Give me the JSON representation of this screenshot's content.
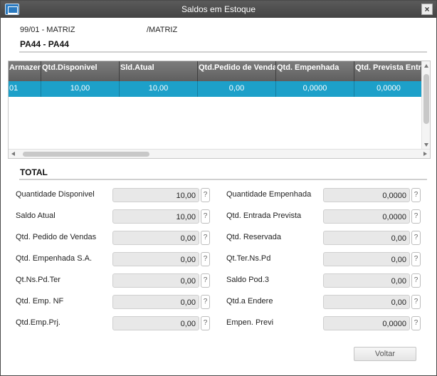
{
  "window": {
    "title": "Saldos em Estoque"
  },
  "header": {
    "branch": "99/01 - MATRIZ",
    "company": "/MATRIZ",
    "product": "PA44 - PA44"
  },
  "grid": {
    "columns": [
      "Armazem",
      "Qtd.Disponivel",
      "Sld.Atual",
      "Qtd.Pedido de Vendas",
      "Qtd. Empenhada",
      "Qtd. Prevista Entrada"
    ],
    "rows": [
      [
        "01",
        "10,00",
        "10,00",
        "0,00",
        "0,0000",
        "0,0000"
      ]
    ]
  },
  "total": {
    "title": "TOTAL",
    "left": [
      {
        "label": "Quantidade Disponivel",
        "value": "10,00"
      },
      {
        "label": "Saldo Atual",
        "value": "10,00"
      },
      {
        "label": "Qtd. Pedido de Vendas",
        "value": "0,00"
      },
      {
        "label": "Qtd. Empenhada S.A.",
        "value": "0,00"
      },
      {
        "label": "Qt.Ns.Pd.Ter",
        "value": "0,00"
      },
      {
        "label": "Qtd. Emp. NF",
        "value": "0,00"
      },
      {
        "label": "Qtd.Emp.Prj.",
        "value": "0,00"
      }
    ],
    "right": [
      {
        "label": "Quantidade Empenhada",
        "value": "0,0000"
      },
      {
        "label": "Qtd. Entrada Prevista",
        "value": "0,0000"
      },
      {
        "label": "Qtd. Reservada",
        "value": "0,00"
      },
      {
        "label": "Qt.Ter.Ns.Pd",
        "value": "0,00"
      },
      {
        "label": "Saldo Pod.3",
        "value": "0,00"
      },
      {
        "label": "Qtd.a Endere",
        "value": "0,00"
      },
      {
        "label": "Empen. Previ",
        "value": "0,0000"
      }
    ],
    "help_glyph": "?"
  },
  "buttons": {
    "close": "×",
    "back": "Voltar"
  },
  "colors": {
    "titlebar": "#4e4e4e",
    "grid_header": "#6e6e6e",
    "selected_row": "#1da0c9"
  },
  "icons": {
    "app": "window-icon",
    "close": "close-icon",
    "help": "help-icon"
  }
}
